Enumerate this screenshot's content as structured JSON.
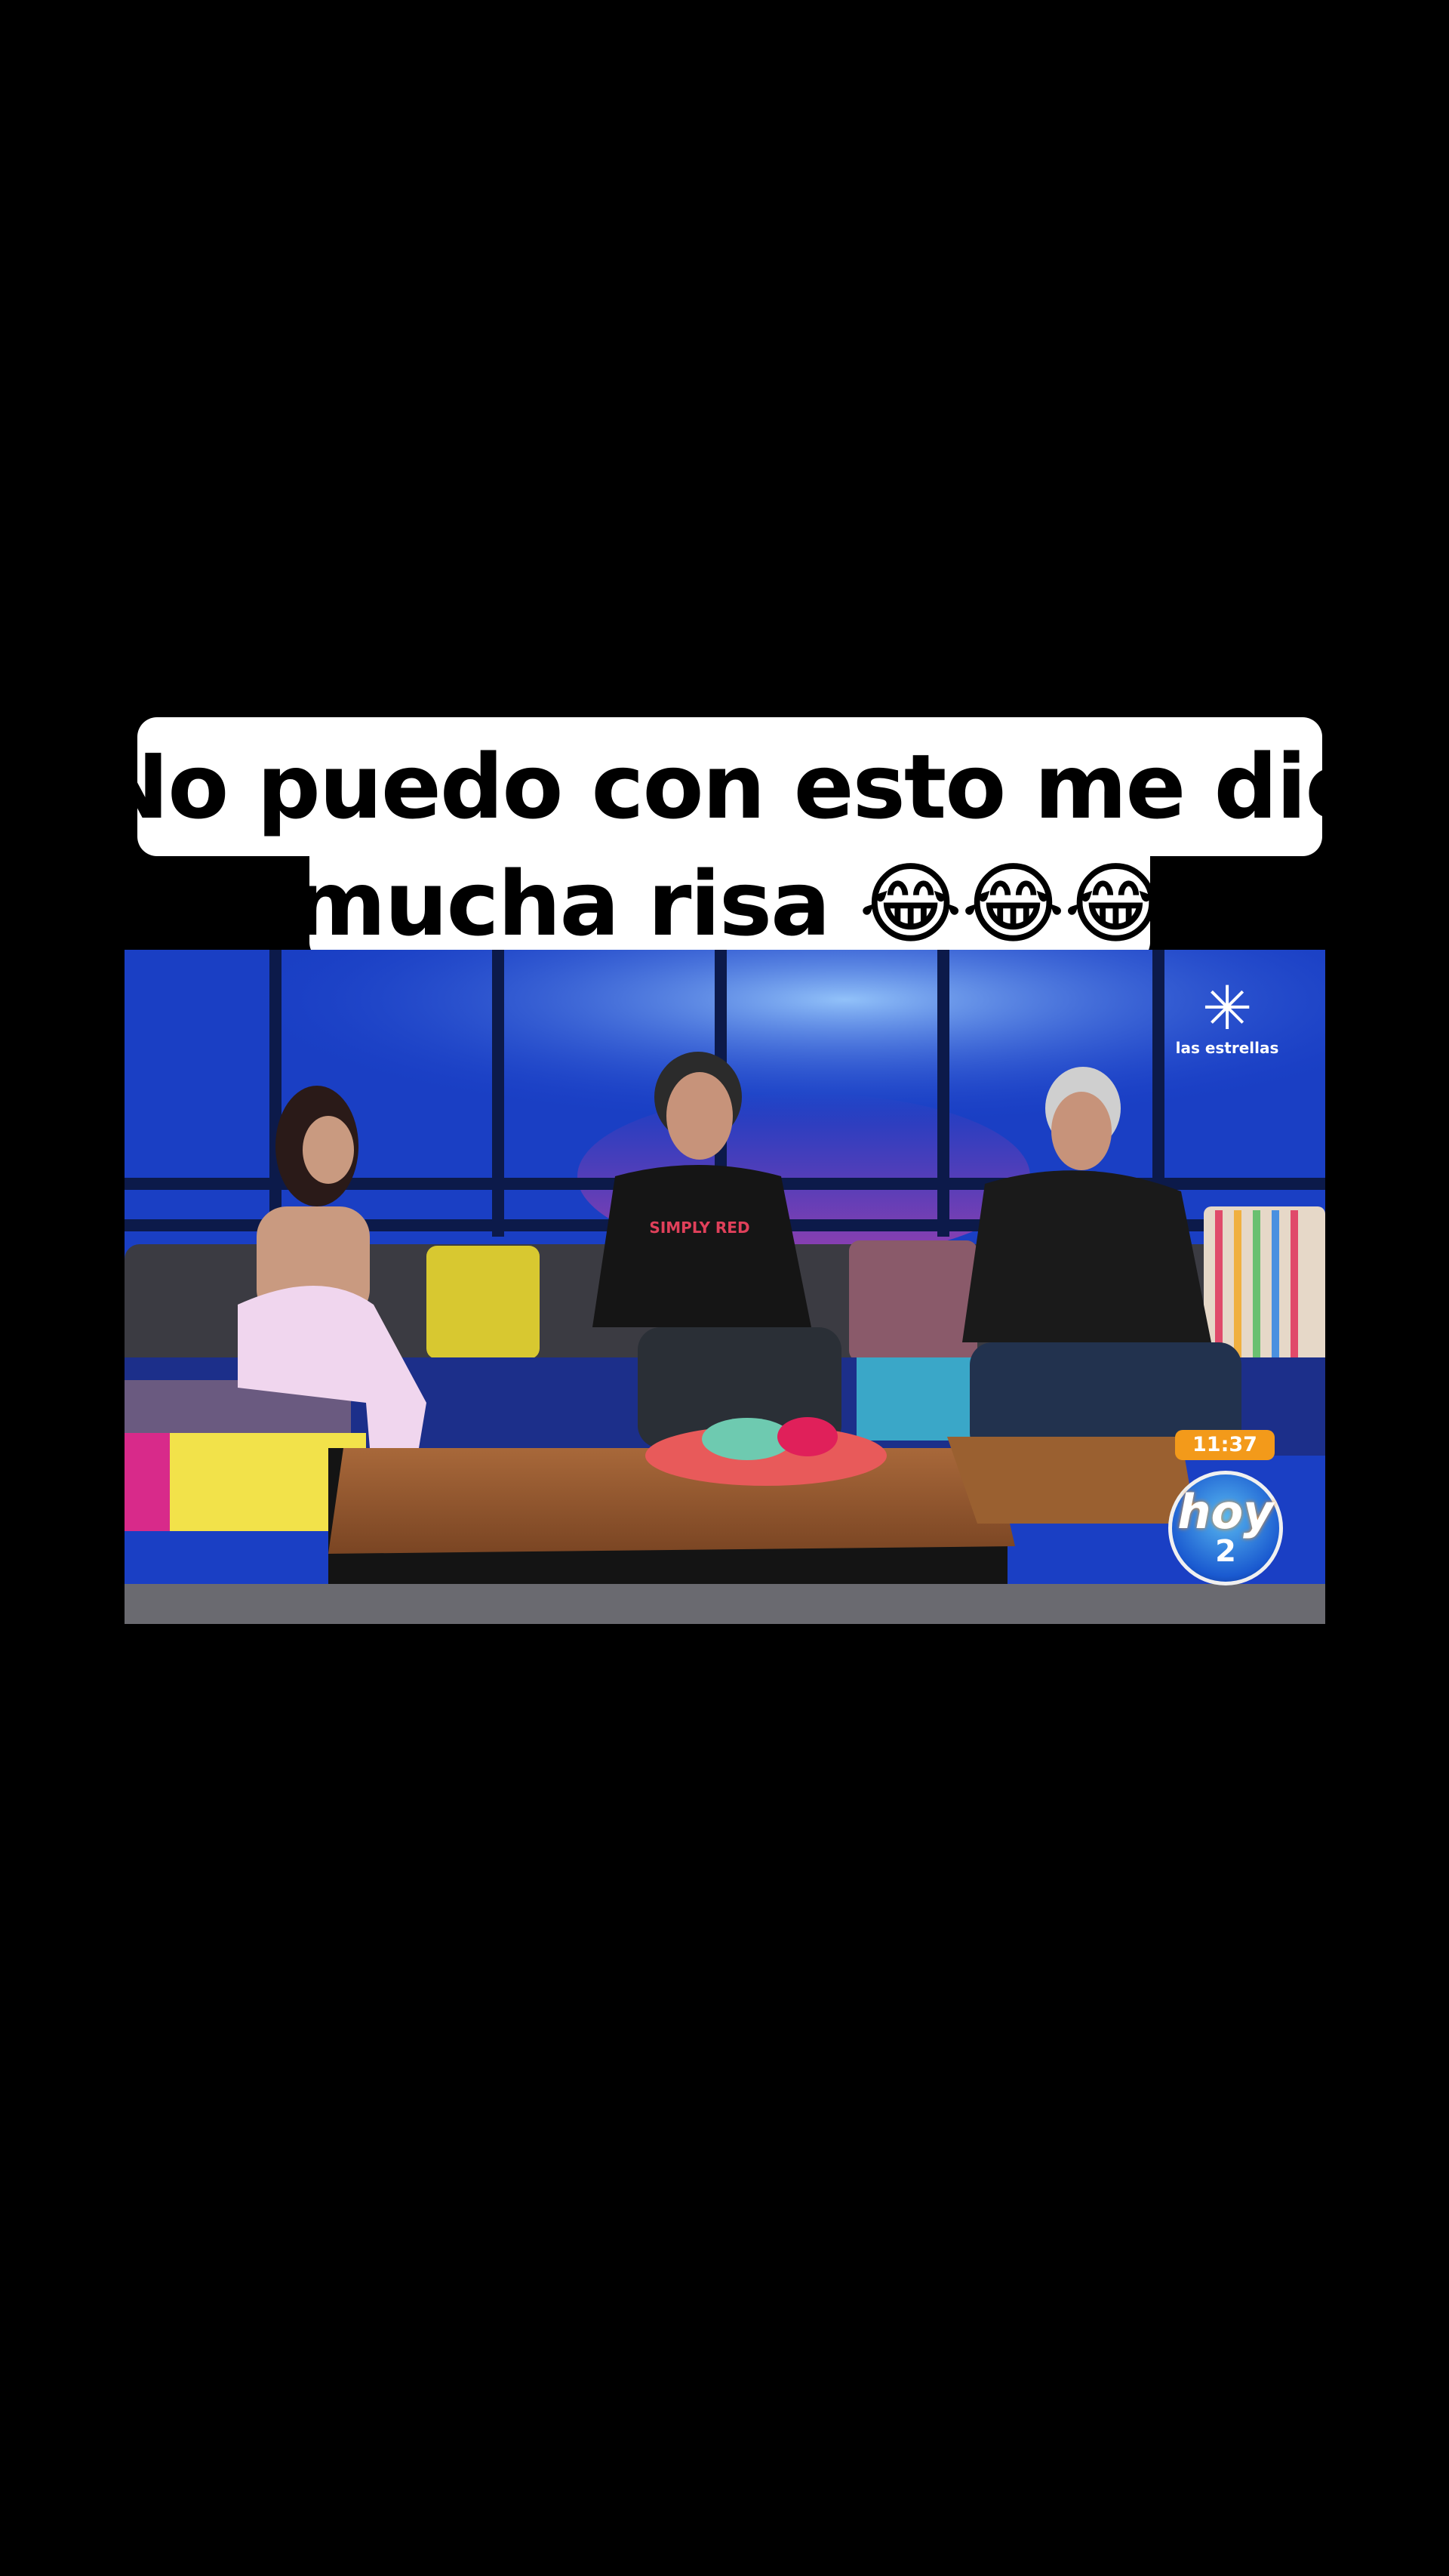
{
  "caption": {
    "line1": "No puedo con esto me dio",
    "line2": "mucha risa 😂😂😂"
  },
  "video": {
    "channel_name": "las estrellas",
    "clock": "11:37",
    "show_logo_text": "hoy",
    "show_logo_number": "2",
    "shirt_text": "SIMPLY RED"
  },
  "colors": {
    "background": "#000000",
    "caption_bg": "#ffffff",
    "studio_blue": "#1b44d0",
    "clock_badge": "#f39a1a"
  }
}
